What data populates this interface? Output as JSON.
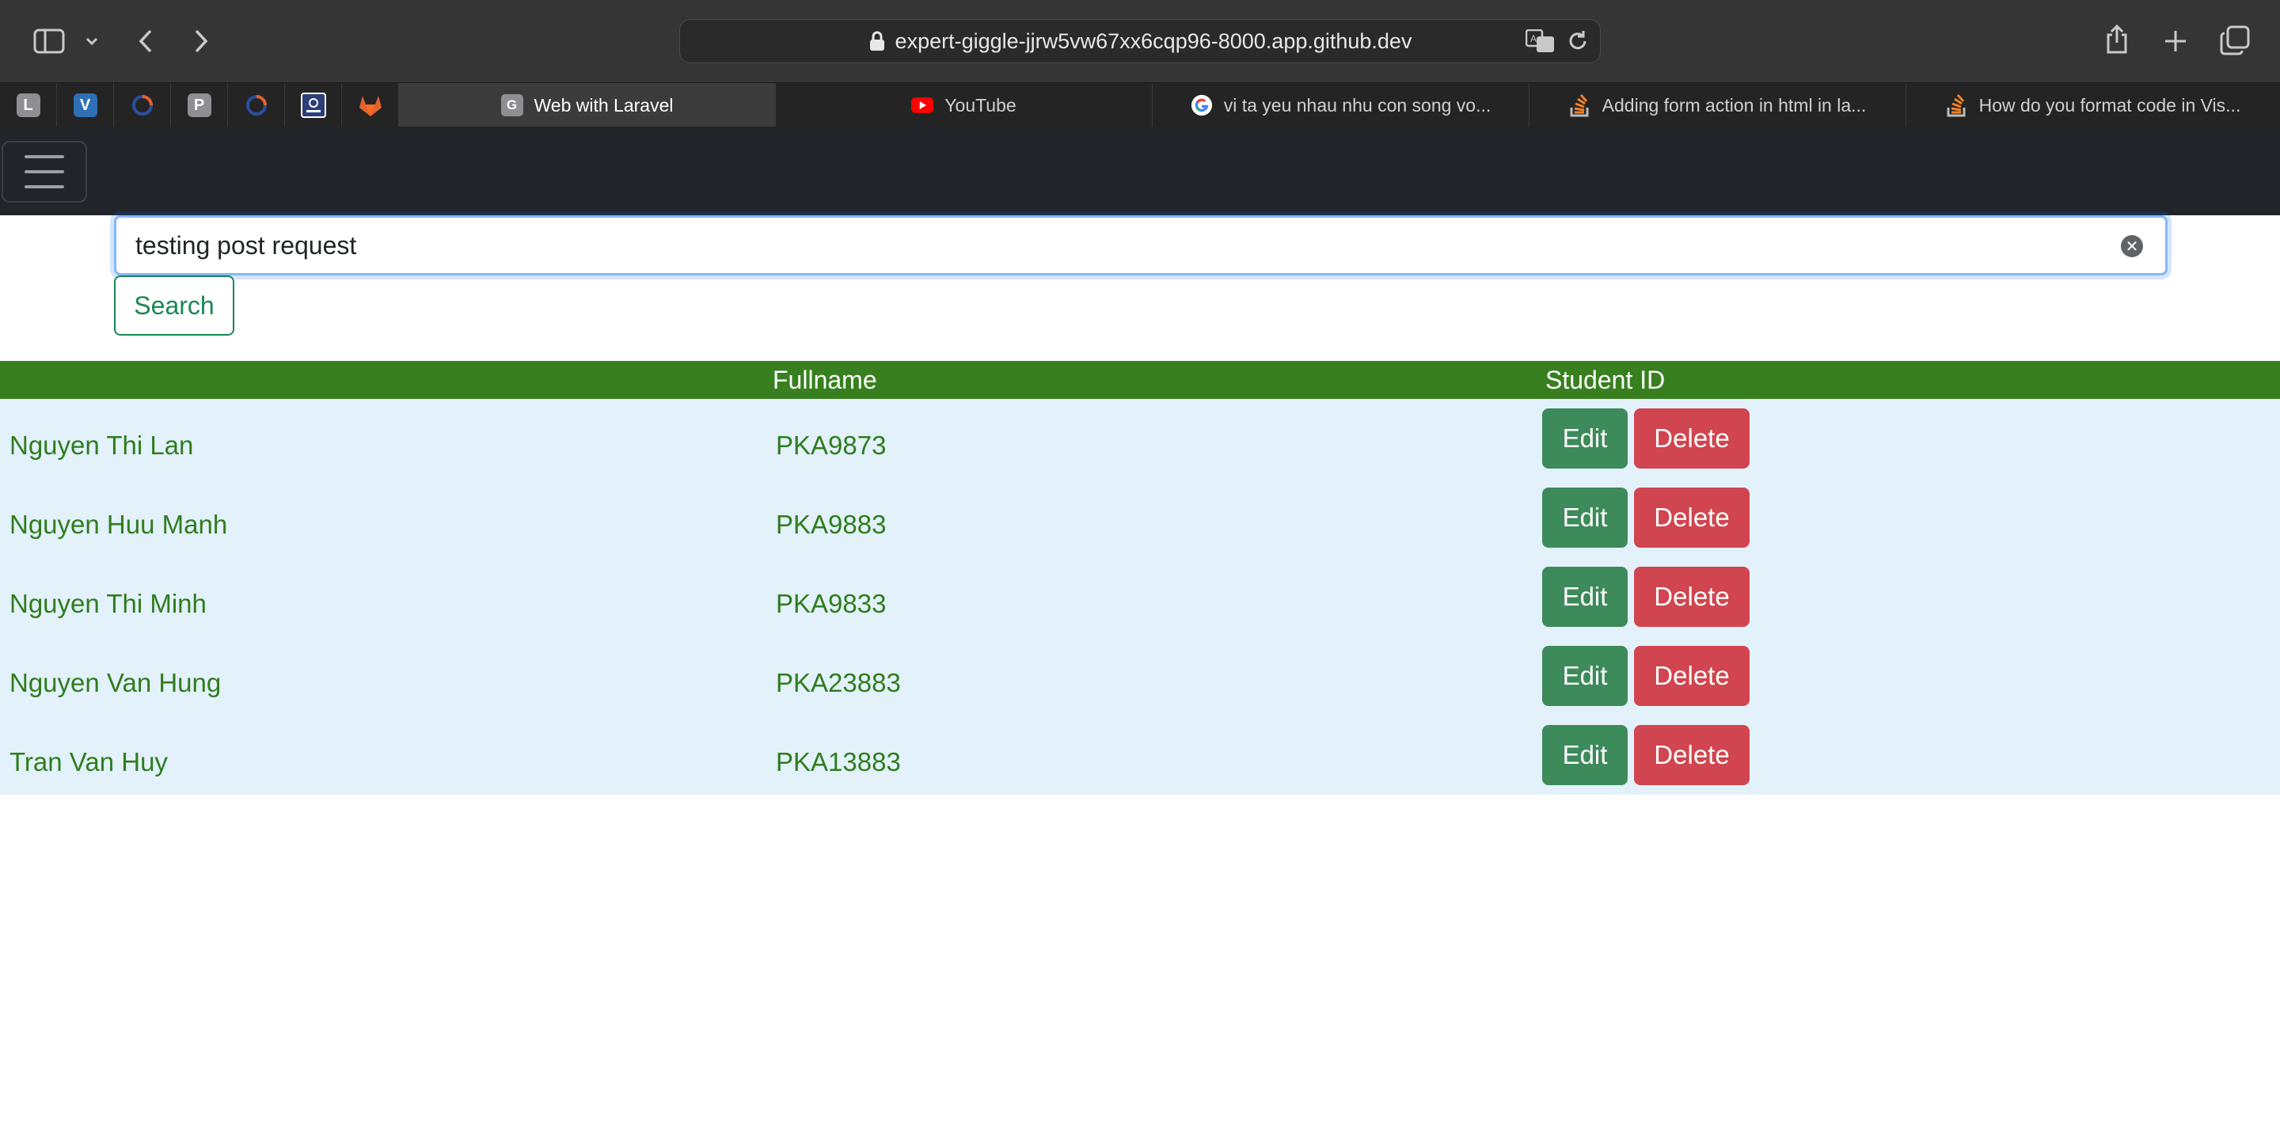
{
  "browser": {
    "url": "expert-giggle-jjrw5vw67xx6cqp96-8000.app.github.dev",
    "pinned_tabs": [
      {
        "letter": "L",
        "color": "#8e8e93"
      },
      {
        "letter": "V",
        "color": "#2f6fb5"
      },
      {
        "letter": "",
        "color": "#c0502f"
      },
      {
        "letter": "P",
        "color": "#8e8e93"
      },
      {
        "letter": "",
        "color": "#2a4fa0"
      },
      {
        "letter": "",
        "color": "#2b3e7a"
      },
      {
        "letter": "",
        "color": "#e2632c"
      }
    ],
    "tabs": [
      {
        "title": "Web with Laravel",
        "icon": "G",
        "active": true
      },
      {
        "title": "YouTube",
        "icon": "youtube-icon",
        "active": false
      },
      {
        "title": "vi ta yeu nhau nhu con song vo...",
        "icon": "google-icon",
        "active": false
      },
      {
        "title": "Adding form action in html in la...",
        "icon": "stackoverflow-icon",
        "active": false
      },
      {
        "title": "How do you format code in Vis...",
        "icon": "stackoverflow-icon",
        "active": false
      }
    ]
  },
  "search": {
    "value": "testing post request",
    "button_label": "Search"
  },
  "table": {
    "headers": [
      "Fullname",
      "Student ID"
    ],
    "rows": [
      {
        "fullname": "Nguyen Thi Lan",
        "student_id": "PKA9873"
      },
      {
        "fullname": "Nguyen Huu Manh",
        "student_id": "PKA9883"
      },
      {
        "fullname": "Nguyen Thi Minh",
        "student_id": "PKA9833"
      },
      {
        "fullname": "Nguyen Van Hung",
        "student_id": "PKA23883"
      },
      {
        "fullname": "Tran Van Huy",
        "student_id": "PKA13883"
      }
    ],
    "edit_label": "Edit",
    "delete_label": "Delete"
  },
  "colors": {
    "header_green": "#38801f",
    "row_text_green": "#2f7d1e",
    "row_bg": "#e3f1fb",
    "edit_btn": "#3d8a5a",
    "delete_btn": "#d0454f",
    "navbar": "#212529"
  }
}
